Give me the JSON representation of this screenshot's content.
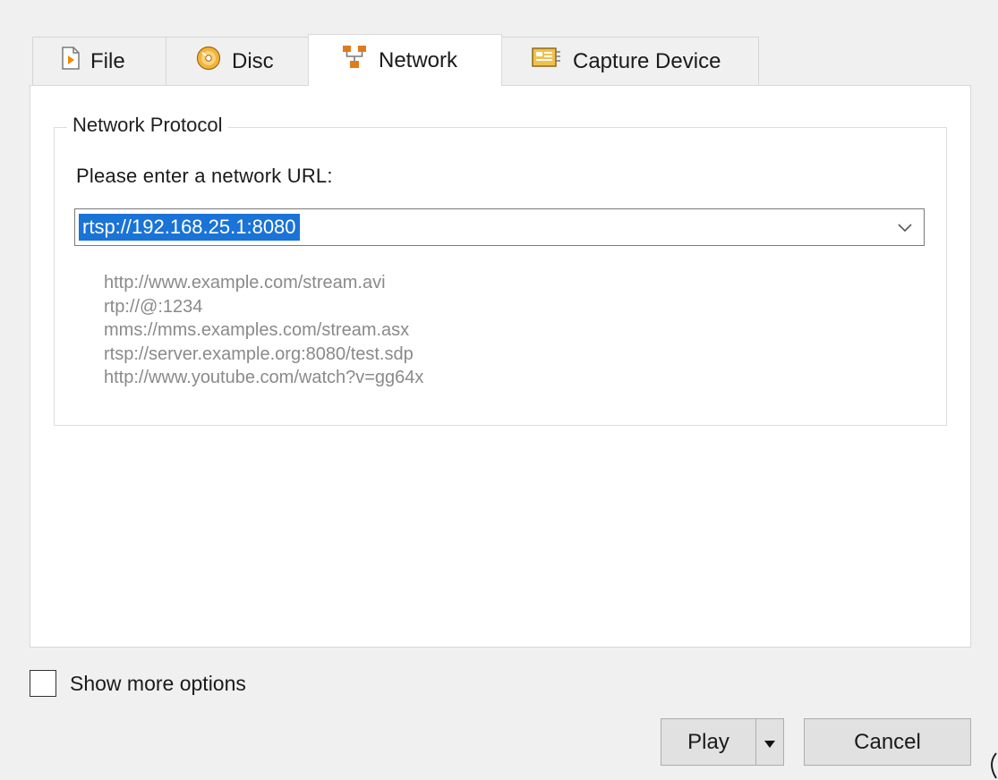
{
  "tabs": [
    {
      "label": "File",
      "icon": "file-play-icon",
      "active": false
    },
    {
      "label": "Disc",
      "icon": "disc-icon",
      "active": false
    },
    {
      "label": "Network",
      "icon": "network-icon",
      "active": true
    },
    {
      "label": "Capture Device",
      "icon": "capture-device-icon",
      "active": false
    }
  ],
  "network": {
    "group_title": "Network Protocol",
    "prompt": "Please enter a network URL:",
    "url_value": "rtsp://192.168.25.1:8080",
    "examples": [
      "http://www.example.com/stream.avi",
      "rtp://@:1234",
      "mms://mms.examples.com/stream.asx",
      "rtsp://server.example.org:8080/test.sdp",
      "http://www.youtube.com/watch?v=gg64x"
    ]
  },
  "options": {
    "show_more_label": "Show more options",
    "show_more_checked": false
  },
  "buttons": {
    "play": "Play",
    "cancel": "Cancel"
  },
  "colors": {
    "selection": "#1a73d6",
    "hint_text": "#8a8a8a",
    "panel_bg": "#ffffff",
    "window_bg": "#f0f0f0"
  }
}
